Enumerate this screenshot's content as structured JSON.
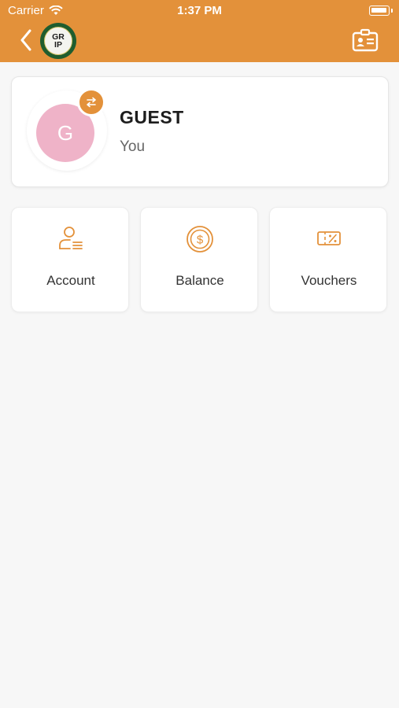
{
  "status_bar": {
    "carrier": "Carrier",
    "time": "1:37 PM"
  },
  "header": {
    "logo_text_top": "GR",
    "logo_text_bottom": "IP",
    "icons": {
      "back": "chevron-left-icon",
      "contact_card": "id-card-icon"
    }
  },
  "profile": {
    "avatar_initial": "G",
    "name": "GUEST",
    "subtitle": "You",
    "avatar_color": "#efb3c8",
    "swap_icon": "swap-arrows-icon"
  },
  "tiles": [
    {
      "label": "Account",
      "icon": "account-list-icon"
    },
    {
      "label": "Balance",
      "icon": "coin-dollar-icon"
    },
    {
      "label": "Vouchers",
      "icon": "voucher-ticket-icon"
    }
  ],
  "colors": {
    "accent": "#e3913a",
    "background": "#f7f7f7",
    "logo_green": "#1f5d2f"
  }
}
